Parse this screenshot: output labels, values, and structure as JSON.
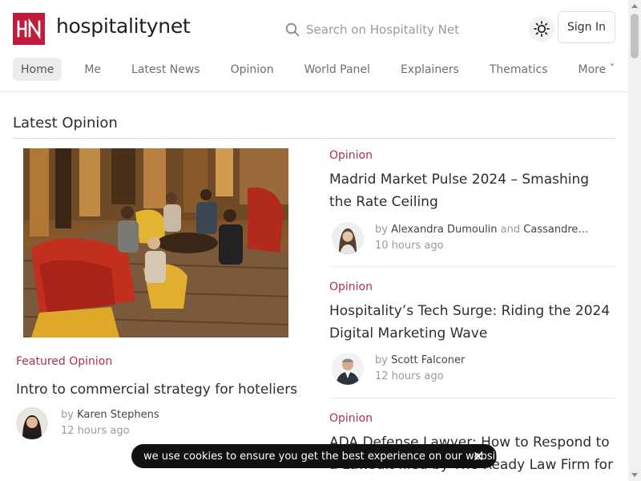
{
  "brand": {
    "logo_letters": "HN",
    "name": "hospitalitynet",
    "accent": "#c01d3c"
  },
  "search": {
    "placeholder": "Search on Hospitality Net",
    "icon": "search-icon"
  },
  "header": {
    "theme_icon": "sun-icon",
    "signin_label": "Sign In"
  },
  "nav": {
    "items": [
      {
        "label": "Home",
        "active": true
      },
      {
        "label": "Me"
      },
      {
        "label": "Latest News"
      },
      {
        "label": "Opinion"
      },
      {
        "label": "World Panel"
      },
      {
        "label": "Explainers"
      },
      {
        "label": "Thematics"
      },
      {
        "label": "More ˇ"
      }
    ]
  },
  "section": {
    "title": "Latest Opinion"
  },
  "featured": {
    "category": "Featured Opinion",
    "title": "Intro to commercial strategy for hoteliers",
    "by": "by",
    "author": "Karen Stephens",
    "time": "12 hours ago"
  },
  "articles": [
    {
      "category": "Opinion",
      "title": "Madrid Market Pulse 2024 – Smashing the Rate Ceiling",
      "by": "by",
      "author": "Alexandra Dumoulin",
      "and": "and",
      "author2": "Cassandre…",
      "time": "10 hours ago"
    },
    {
      "category": "Opinion",
      "title": "Hospitality’s Tech Surge: Riding the 2024 Digital Marketing Wave",
      "by": "by",
      "author": "Scott Falconer",
      "time": "12 hours ago"
    },
    {
      "category": "Opinion",
      "title": "ADA Defense Lawyer: How to Respond to a Lawsuit filed by The Ready Law Firm for"
    }
  ],
  "cookie": {
    "text": "we use cookies to ensure you get the best experience on our website"
  }
}
